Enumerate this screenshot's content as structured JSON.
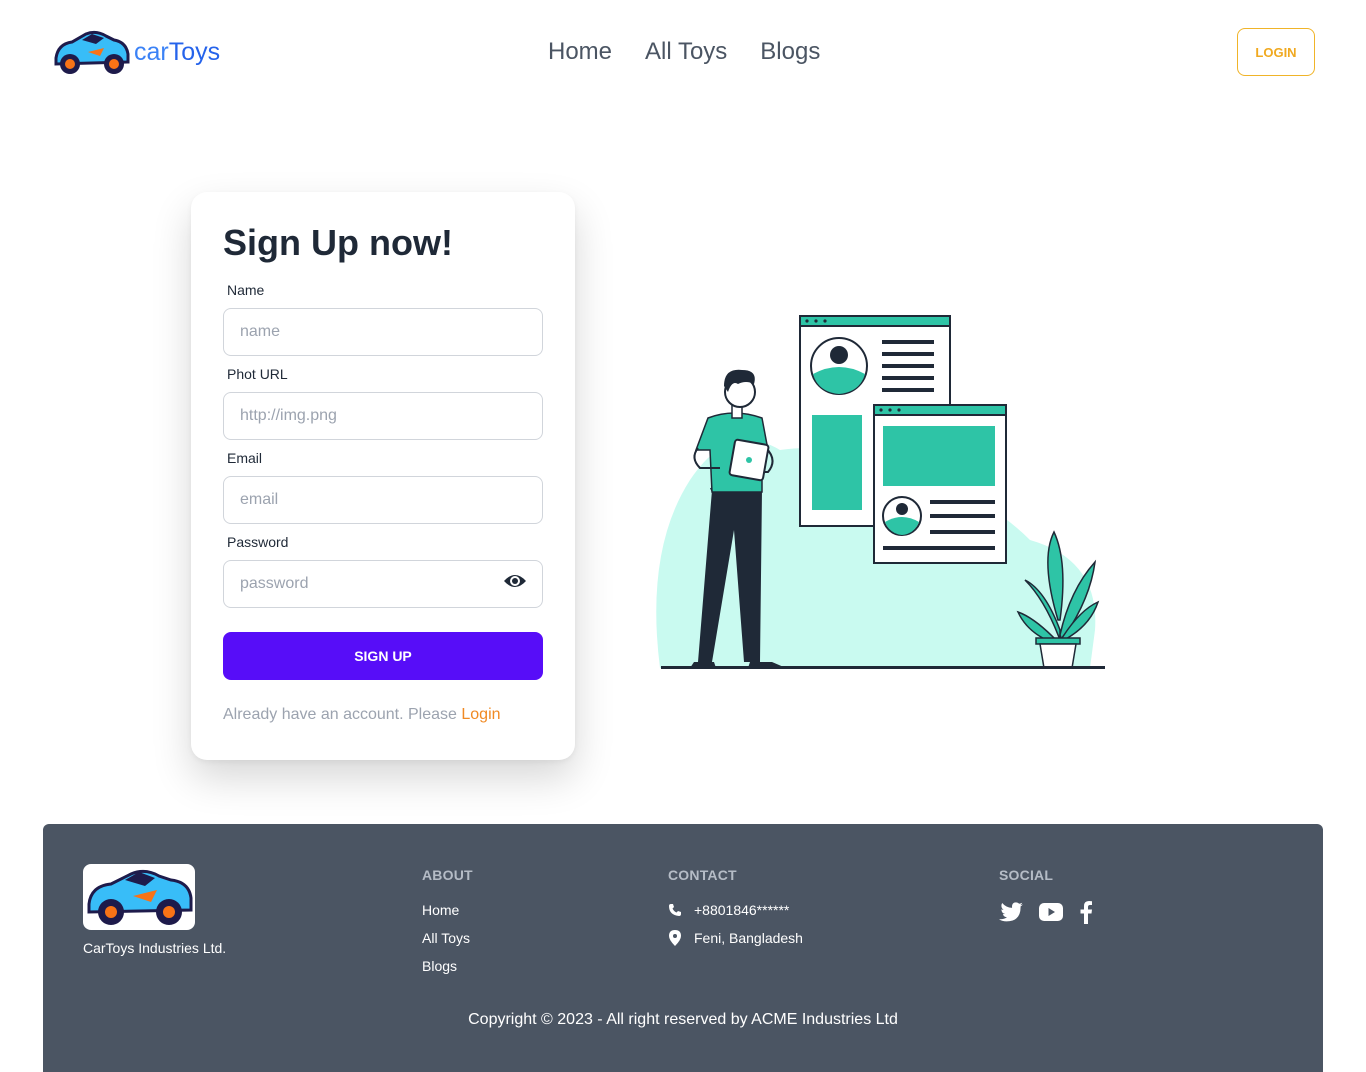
{
  "header": {
    "logo": {
      "part1": "car",
      "part2": "Toys",
      "icon": "car-icon"
    },
    "nav": [
      {
        "label": "Home"
      },
      {
        "label": "All Toys"
      },
      {
        "label": "Blogs"
      }
    ],
    "login_label": "LOGIN"
  },
  "form": {
    "title": "Sign Up now!",
    "fields": {
      "name": {
        "label": "Name",
        "placeholder": "name"
      },
      "photo": {
        "label": "Phot URL",
        "placeholder": "http://img.png"
      },
      "email": {
        "label": "Email",
        "placeholder": "email"
      },
      "password": {
        "label": "Password",
        "placeholder": "password",
        "icon": "eye-icon"
      }
    },
    "submit_label": "SIGN UP",
    "already_text": "Already have an account. Please ",
    "login_link": "Login"
  },
  "footer": {
    "company": "CarToys Industries Ltd.",
    "about": {
      "title": "ABOUT",
      "links": [
        "Home",
        "All Toys",
        "Blogs"
      ]
    },
    "contact": {
      "title": "CONTACT",
      "phone": "+8801846******",
      "address": "Feni, Bangladesh"
    },
    "social": {
      "title": "SOCIAL",
      "icons": [
        "twitter-icon",
        "youtube-icon",
        "facebook-icon"
      ]
    },
    "copyright": "Copyright © 2023 - All right reserved by ACME Industries Ltd"
  },
  "colors": {
    "primary": "#570df8",
    "accent": "#f08a24",
    "illustration": "#2ec4a6",
    "footer_bg": "#4b5563"
  }
}
